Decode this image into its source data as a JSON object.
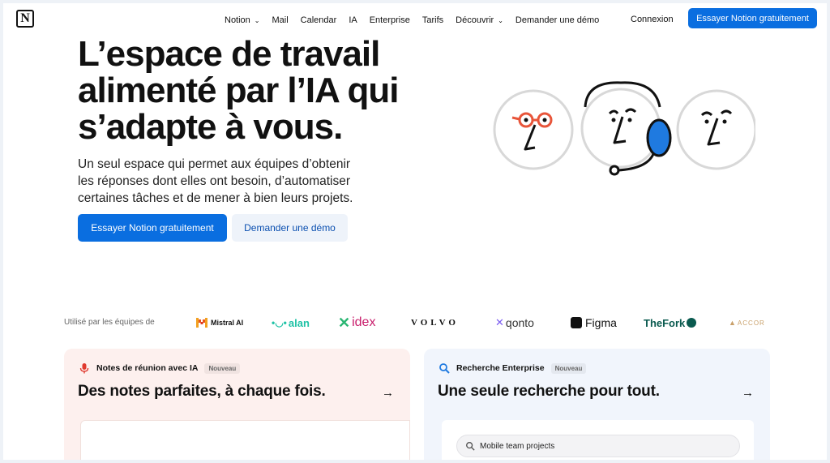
{
  "nav": {
    "logo": "N",
    "links": [
      {
        "label": "Notion",
        "has_menu": true
      },
      {
        "label": "Mail",
        "has_menu": false
      },
      {
        "label": "Calendar",
        "has_menu": false
      },
      {
        "label": "IA",
        "has_menu": false
      },
      {
        "label": "Enterprise",
        "has_menu": false
      },
      {
        "label": "Tarifs",
        "has_menu": false
      },
      {
        "label": "Découvrir",
        "has_menu": true
      },
      {
        "label": "Demander une démo",
        "has_menu": false
      }
    ],
    "login": "Connexion",
    "cta": "Essayer Notion gratuitement"
  },
  "hero": {
    "title_lines": [
      "L’espace de travail",
      "alimenté par l’IA qui",
      "s’adapte à vous."
    ],
    "subtitle_lines": [
      "Un seul espace qui permet aux équipes d’obtenir",
      "les réponses dont elles ont besoin, d’automatiser",
      "certaines tâches et de mener à bien leurs projets."
    ],
    "primary_button": "Essayer Notion gratuitement",
    "secondary_button": "Demander une démo"
  },
  "logos": {
    "label": "Utilisé par les équipes de",
    "items": [
      {
        "name": "Mistral AI",
        "color": "#e8541e"
      },
      {
        "name": "alan",
        "color": "#1fc2a6"
      },
      {
        "name": "idex",
        "color": "#c81d6b"
      },
      {
        "name": "VOLVO",
        "color": "#111111"
      },
      {
        "name": "qonto",
        "color": "#333333"
      },
      {
        "name": "Figma",
        "color": "#111111"
      },
      {
        "name": "TheFork",
        "color": "#0a5a4f"
      },
      {
        "name": "ACCOR",
        "color": "#c9a06a"
      }
    ]
  },
  "cards": [
    {
      "tag": "Notes de réunion avec IA",
      "icon": "microphone-icon",
      "badge": "Nouveau",
      "title": "Des notes parfaites, à chaque fois.",
      "accent": "#e03a2f"
    },
    {
      "tag": "Recherche Enterprise",
      "icon": "search-icon",
      "badge": "Nouveau",
      "title": "Une seule recherche pour tout.",
      "accent": "#1f7ae0",
      "search_value": "Mobile team projects"
    }
  ],
  "colors": {
    "brand_blue": "#0a6ee0",
    "illustration_blue": "#1f7ae0",
    "illustration_red": "#e8553a"
  }
}
